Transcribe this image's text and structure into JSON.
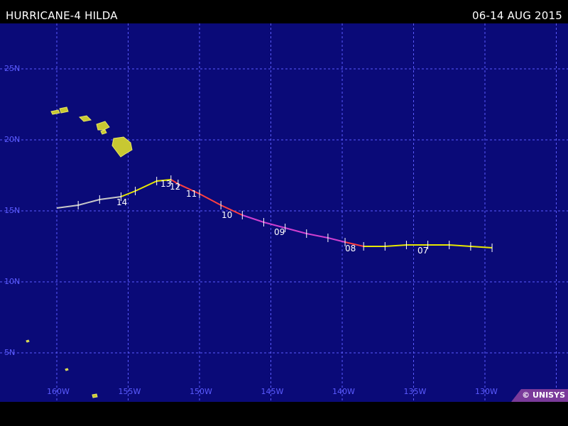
{
  "header": {
    "title": "HURRICANE-4 HILDA",
    "dates": "06-14 AUG 2015"
  },
  "map": {
    "background": "#0a0a78",
    "grid_color": "#5b5bff",
    "land_color": "#c8c832",
    "lat_labels": [
      "25N",
      "20N",
      "15N",
      "10N",
      "5N"
    ],
    "lon_labels": [
      "160W",
      "155W",
      "150W",
      "145W",
      "140W",
      "135W",
      "130W"
    ],
    "credit": "© UNISYS"
  },
  "track": {
    "day_labels": [
      "07",
      "08",
      "09",
      "10",
      "11",
      "12",
      "13",
      "14"
    ],
    "segments": [
      {
        "color": "#e8e800",
        "points": [
          [
            -129.5,
            12.4
          ],
          [
            -131,
            12.5
          ],
          [
            -132.5,
            12.6
          ],
          [
            -134,
            12.6
          ],
          [
            -135.5,
            12.6
          ],
          [
            -137,
            12.5
          ],
          [
            -138.5,
            12.5
          ]
        ]
      },
      {
        "color": "#ff4040",
        "points": [
          [
            -138.5,
            12.5
          ],
          [
            -139.8,
            12.8
          ]
        ]
      },
      {
        "color": "#d040d0",
        "points": [
          [
            -139.8,
            12.8
          ],
          [
            -141,
            13.1
          ],
          [
            -142.5,
            13.4
          ],
          [
            -144,
            13.8
          ],
          [
            -145.5,
            14.2
          ],
          [
            -147,
            14.7
          ]
        ]
      },
      {
        "color": "#ff4040",
        "points": [
          [
            -147,
            14.7
          ],
          [
            -148.5,
            15.4
          ],
          [
            -150,
            16.2
          ],
          [
            -151.5,
            16.9
          ],
          [
            -152,
            17.2
          ]
        ]
      },
      {
        "color": "#e8e800",
        "points": [
          [
            -152,
            17.2
          ],
          [
            -153,
            17.1
          ],
          [
            -154.5,
            16.4
          ],
          [
            -155.5,
            16.0
          ]
        ]
      },
      {
        "color": "#c8c8c8",
        "points": [
          [
            -155.5,
            16.0
          ],
          [
            -157,
            15.8
          ],
          [
            -158.5,
            15.4
          ],
          [
            -160,
            15.2
          ]
        ]
      }
    ],
    "ticks": [
      [
        -129.5,
        12.4
      ],
      [
        -131,
        12.5
      ],
      [
        -132.5,
        12.6
      ],
      [
        -134,
        12.6
      ],
      [
        -135.5,
        12.6
      ],
      [
        -137,
        12.5
      ],
      [
        -138.5,
        12.5
      ],
      [
        -139.8,
        12.8
      ],
      [
        -141,
        13.1
      ],
      [
        -142.5,
        13.4
      ],
      [
        -144,
        13.8
      ],
      [
        -145.5,
        14.2
      ],
      [
        -147,
        14.7
      ],
      [
        -148.5,
        15.4
      ],
      [
        -150,
        16.2
      ],
      [
        -151.5,
        16.9
      ],
      [
        -152,
        17.2
      ],
      [
        -153,
        17.1
      ],
      [
        -154.5,
        16.4
      ],
      [
        -155.5,
        16.0
      ],
      [
        -157,
        15.8
      ],
      [
        -158.5,
        15.4
      ]
    ]
  }
}
